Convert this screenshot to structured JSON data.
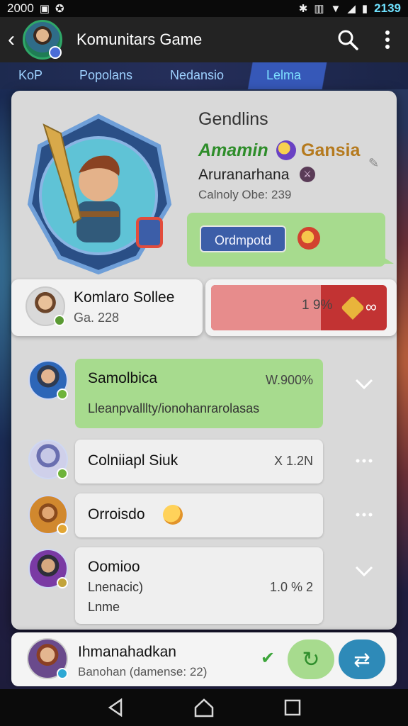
{
  "status_bar": {
    "left_text": "2000",
    "time": "2139"
  },
  "app_bar": {
    "title": "Komunitars Game"
  },
  "tabs": [
    {
      "label": "KoP"
    },
    {
      "label": "Popolans"
    },
    {
      "label": "Nedansio"
    },
    {
      "label": "Lelma",
      "active": true
    }
  ],
  "hero": {
    "title": "Gendlins",
    "guild_green": "Amamin",
    "guild_gold": "Gansia",
    "subtitle": "Aruranarhana",
    "meta": "Calnoly Obe: 239",
    "status_chip": "Ordmpotd"
  },
  "player": {
    "name": "Komlaro Sollee",
    "sub": "Ga. 228"
  },
  "progress": {
    "text": "1 9%",
    "fill_percent": 19
  },
  "messages": [
    {
      "name": "Samolbica",
      "value": "W.900%",
      "text": "Lleanpvalllty/ionohanrarolasas",
      "style": "green"
    },
    {
      "name": "Colniiapl Siuk",
      "value": "X 1.2N",
      "style": "white"
    },
    {
      "name": "Orroisdo",
      "style": "white"
    },
    {
      "name": "Oomioo",
      "value": "1.0 % 2",
      "text": "Lnenacic)",
      "text2": "Lnme",
      "style": "white"
    }
  ],
  "footer": {
    "name": "Ihmanahadkan",
    "sub": "Banohan (damеnse: 22)"
  },
  "colors": {
    "accent_green": "#a7db8e",
    "accent_blue": "#3c5ea8",
    "danger_red": "#c23333",
    "appbar": "#232323"
  }
}
